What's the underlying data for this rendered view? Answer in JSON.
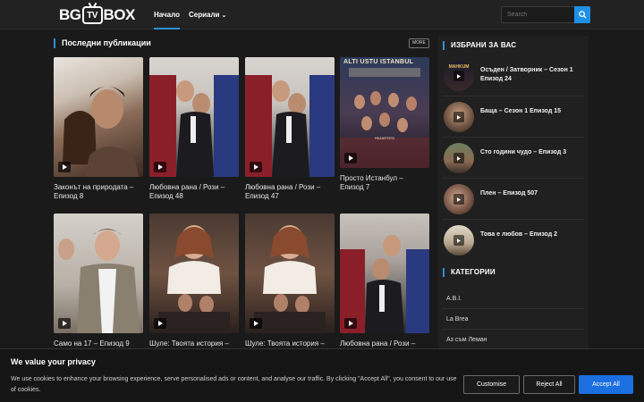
{
  "header": {
    "logo": {
      "left": "BG",
      "tv": "TV",
      "right": "BOX"
    },
    "nav": [
      {
        "label": "Начало",
        "active": true
      },
      {
        "label": "Сериали",
        "dropdown": true
      }
    ],
    "search_placeholder": "Search"
  },
  "latest": {
    "title": "Последни публикации",
    "more_label": "MORE",
    "cards": [
      {
        "title": "Законът на природата – Епизод 8"
      },
      {
        "title": "Любовна рана / Рози – Епизод 48"
      },
      {
        "title": "Любовна рана / Рози – Епизод 47"
      },
      {
        "title": "Просто Истанбул – Епизод 7",
        "poster_text": "ALTI USTU ISTANBUL",
        "poster_subtext": "PAZARTESI"
      },
      {
        "title": "Само на 17 – Епизод 9"
      },
      {
        "title": "Шуле: Твоята история –"
      },
      {
        "title": "Шуле: Твоята история –"
      },
      {
        "title": "Любовна рана / Рози –"
      }
    ]
  },
  "sidebar": {
    "featured_title": "ИЗБРАНИ ЗА ВАС",
    "featured": [
      {
        "title": "Осъден / Затворник – Сезон 1 Епизод 24",
        "thumb_text": "MAHKUM"
      },
      {
        "title": "Баща – Сезон 1 Епизод 15"
      },
      {
        "title": "Сто години чудо – Епизод 3"
      },
      {
        "title": "Плен – Епизод 507"
      },
      {
        "title": "Това е любов – Епизод 2"
      }
    ],
    "categories_title": "КАТЕГОРИИ",
    "categories": [
      "A.B.I.",
      "La Brea",
      "Аз съм Леман"
    ]
  },
  "cookie_banner": {
    "title": "We value your privacy",
    "text": "We use cookies to enhance your browsing experience, serve personalised ads or content, and analyse our traffic. By clicking \"Accept All\", you consent to our use of cookies.",
    "customise_label": "Customise",
    "reject_label": "Reject All",
    "accept_label": "Accept All"
  },
  "colors": {
    "accent": "#2b8fd6",
    "accept_button": "#1b6fe0",
    "background": "#1a1a1a"
  }
}
